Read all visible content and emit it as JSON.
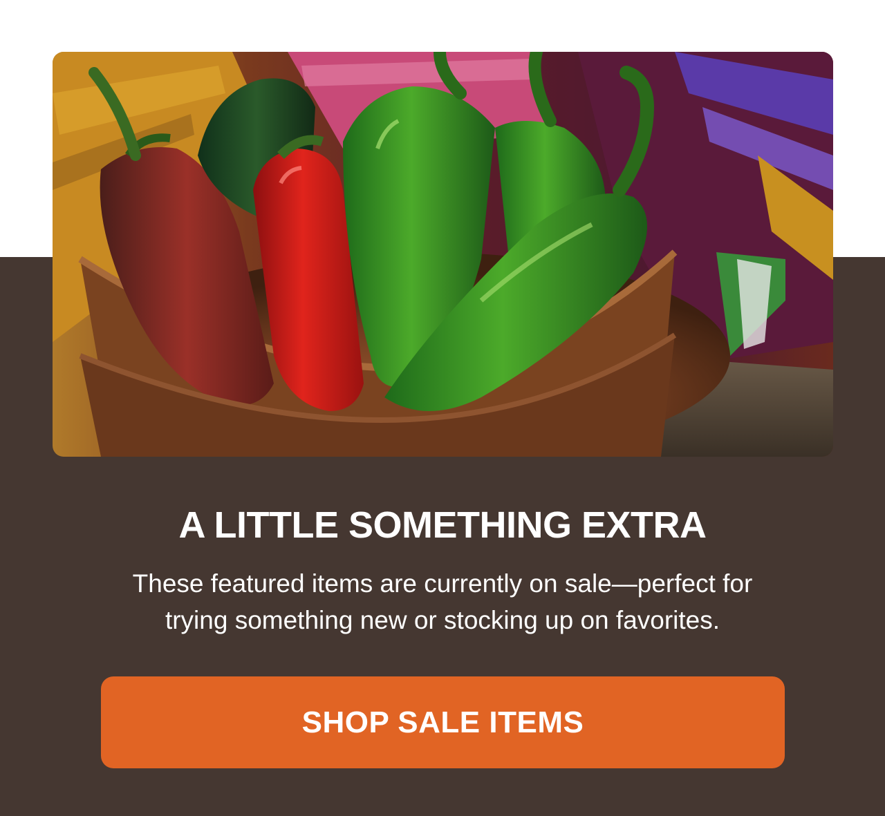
{
  "hero": {
    "image_alt": "Bowl of red and green jalapeño peppers on a colorful woven blanket"
  },
  "headline": "A LITTLE SOMETHING EXTRA",
  "body": {
    "line1": "These featured items are currently on sale—perfect for",
    "line2": "trying something new or stocking up on favorites."
  },
  "cta": {
    "label": "SHOP SALE ITEMS"
  },
  "colors": {
    "panel": "#453731",
    "cta": "#e16424",
    "text": "#ffffff",
    "top": "#ffffff"
  }
}
